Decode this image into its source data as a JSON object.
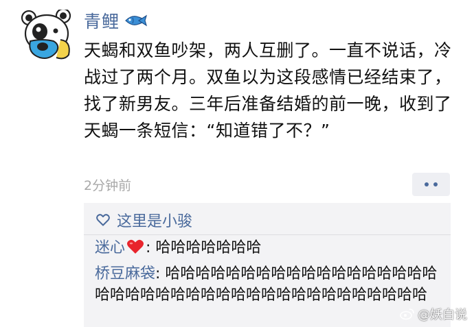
{
  "post": {
    "author": "青鲤",
    "author_emoji": "fish-icon",
    "text": "天蝎和双鱼吵架，两人互删了。一直不说话，冷战过了两个月。双鱼以为这段感情已经结束了，找了新男友。三年后准备结婚的前一晚，收到了天蝎一条短信：“知道错了不？”",
    "time": "2分钟前"
  },
  "likes": {
    "icon": "heart-outline-icon",
    "names": "这里是小骏"
  },
  "comments": [
    {
      "author": "迷心",
      "emoji": "red-heart-icon",
      "separator": ": ",
      "text": "哈哈哈哈哈哈哈"
    },
    {
      "author": "桥豆麻袋",
      "separator": ": ",
      "text": "哈哈哈哈哈哈哈哈哈哈哈哈哈哈哈哈哈哈哈哈哈哈哈哈哈哈哈哈哈哈哈哈哈哈哈哈哈哈哈哈"
    }
  ],
  "watermark": {
    "text": "@妖白说",
    "icon": "weibo-icon"
  },
  "colors": {
    "link_blue": "#4a6a9c",
    "timestamp_gray": "#a8a8a8",
    "box_bg": "#f3f3f5",
    "heart_red": "#e8242c"
  }
}
